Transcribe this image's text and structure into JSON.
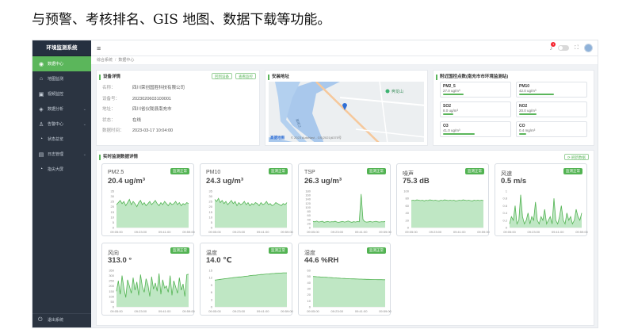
{
  "caption": "与预警、考核排名、GIS 地图、数据下载等功能。",
  "sidebar": {
    "brand": "环境监测系统",
    "items": [
      {
        "label": "数据中心",
        "icon": "camera-icon",
        "glyph": "◉",
        "active": true,
        "chevron": ""
      },
      {
        "label": "地图监测",
        "icon": "map-icon",
        "glyph": "⌂",
        "active": false,
        "chevron": ""
      },
      {
        "label": "视频监控",
        "icon": "video-icon",
        "glyph": "▣",
        "active": false,
        "chevron": ""
      },
      {
        "label": "数据分析",
        "icon": "analysis-icon",
        "glyph": "◈",
        "active": false,
        "chevron": "⌄"
      },
      {
        "label": "告警中心",
        "icon": "alarm-icon",
        "glyph": "♙",
        "active": false,
        "chevron": "⌄"
      },
      {
        "label": "状态总览",
        "icon": "status-icon",
        "glyph": "◔",
        "active": false,
        "chevron": ""
      },
      {
        "label": "日志管理",
        "icon": "log-icon",
        "glyph": "▤",
        "active": false,
        "chevron": "⌄"
      },
      {
        "label": "指尖大屏",
        "icon": "screen-icon",
        "glyph": "◔",
        "active": false,
        "chevron": ""
      }
    ],
    "logout": "退出系统"
  },
  "topbar": {
    "hamburger": "≡",
    "notify_count": "1",
    "bell_glyph": "🔔",
    "fullscreen_glyph": "⛶"
  },
  "breadcrumb": [
    "综合系统",
    "数据中心"
  ],
  "device": {
    "title": "设备详情",
    "btn1": "回到设备",
    "btn2": "查看监控",
    "rows": [
      {
        "k": "名称：",
        "v": "四川荣创国胜科技有限公司"
      },
      {
        "k": "设备号：",
        "v": "2023020603100001"
      },
      {
        "k": "地址：",
        "v": "四川省仪陇县南充市"
      },
      {
        "k": "状态：",
        "v": "在线"
      },
      {
        "k": "数据时间：",
        "v": "2023-03-17 10:04:00"
      }
    ]
  },
  "map": {
    "title": "安装地址",
    "poi": "奔龙山",
    "logo": "高德地图",
    "copyright": "© 2023 AutoNavi - GS(2021)6375号",
    "road": "嘉陵江"
  },
  "air": {
    "title": "附近国控点数(南充市市环境监测站)",
    "items": [
      {
        "name": "PM2_5",
        "value": "27.0 ug/m³",
        "fill": 0.3
      },
      {
        "name": "PM10",
        "value": "42.0 ug/m³",
        "fill": 0.5
      },
      {
        "name": "SO2",
        "value": "8.0 ug/m³",
        "fill": 0.15
      },
      {
        "name": "NO2",
        "value": "20.0 ug/m³",
        "fill": 0.25
      },
      {
        "name": "O3",
        "value": "41.0 ug/m³",
        "fill": 0.45
      },
      {
        "name": "CO",
        "value": "0.4 mg/m³",
        "fill": 0.1
      }
    ]
  },
  "realtime": {
    "title": "实时监测数据详情",
    "refresh": "⟳ 刷新数据"
  },
  "chart_data": [
    {
      "type": "area",
      "name": "PM2.5",
      "display": "20.4 ug/m³",
      "badge": "监测正常",
      "ylim": [
        0,
        35
      ],
      "yticks": [
        0,
        5,
        10,
        15,
        20,
        25,
        30,
        35
      ],
      "xticks": [
        "09:05:00",
        "09:23:00",
        "09:41:00",
        "09:59:00"
      ],
      "values": [
        22,
        24,
        26,
        23,
        25,
        21,
        24,
        27,
        22,
        25,
        23,
        20,
        24,
        26,
        22,
        24,
        21,
        23,
        25,
        22,
        24,
        26,
        23,
        21,
        24,
        22,
        25,
        23,
        21,
        24,
        22,
        23,
        25,
        22,
        24,
        21,
        23,
        22,
        24,
        23
      ]
    },
    {
      "type": "area",
      "name": "PM10",
      "display": "24.3 ug/m³",
      "badge": "监测正常",
      "ylim": [
        0,
        35
      ],
      "yticks": [
        0,
        5,
        10,
        15,
        20,
        25,
        30,
        35
      ],
      "xticks": [
        "09:05:00",
        "09:23:00",
        "09:41:00",
        "09:59:00"
      ],
      "values": [
        27,
        25,
        28,
        24,
        26,
        23,
        25,
        22,
        24,
        26,
        23,
        25,
        21,
        24,
        22,
        23,
        25,
        22,
        24,
        21,
        23,
        22,
        24,
        23,
        21,
        24,
        22,
        23,
        25,
        22,
        23,
        21,
        22,
        24,
        23,
        22,
        21,
        23,
        22,
        24
      ]
    },
    {
      "type": "area",
      "name": "TSP",
      "display": "26.3 ug/m³",
      "badge": "监测正常",
      "ylim": [
        0,
        180
      ],
      "yticks": [
        0,
        20,
        40,
        60,
        80,
        100,
        120,
        140,
        160,
        180
      ],
      "xticks": [
        "09:05:00",
        "09:23:00",
        "09:41:00",
        "09:59:00"
      ],
      "values": [
        30,
        28,
        32,
        27,
        29,
        31,
        26,
        28,
        30,
        27,
        29,
        28,
        31,
        27,
        26,
        28,
        30,
        27,
        29,
        32,
        28,
        26,
        29,
        27,
        30,
        28,
        165,
        40,
        29,
        27,
        28,
        30,
        27,
        29,
        31,
        28,
        27,
        29,
        28,
        30
      ]
    },
    {
      "type": "area",
      "name": "噪声",
      "display": "75.3 dB",
      "badge": "监测正常",
      "ylim": [
        0,
        100
      ],
      "yticks": [
        0,
        20,
        40,
        60,
        80,
        100
      ],
      "xticks": [
        "09:05:00",
        "09:23:00",
        "09:41:00",
        "09:59:00"
      ],
      "values": [
        74,
        75,
        74,
        76,
        75,
        74,
        75,
        73,
        75,
        74,
        76,
        75,
        74,
        75,
        74,
        73,
        75,
        74,
        76,
        75,
        74,
        75,
        74,
        75,
        73,
        74,
        75,
        74,
        76,
        75,
        74,
        75,
        74,
        73,
        75,
        74,
        75,
        74,
        75,
        74
      ]
    },
    {
      "type": "area",
      "name": "风速",
      "display": "0.5 m/s",
      "badge": "监测正常",
      "ylim": [
        0,
        1
      ],
      "yticks": [
        0,
        0.2,
        0.4,
        0.6,
        0.8,
        1
      ],
      "xticks": [
        "09:05:00",
        "09:23:00",
        "09:41:00",
        "09:59:00"
      ],
      "values": [
        0.1,
        0.3,
        0.2,
        0.6,
        0.1,
        0.2,
        0.9,
        0.3,
        0.1,
        0.2,
        0.4,
        0.1,
        0.3,
        0.2,
        0.7,
        0.2,
        0.1,
        0.3,
        0.2,
        0.5,
        0.1,
        0.2,
        0.3,
        0.1,
        0.8,
        0.2,
        0.1,
        0.3,
        0.6,
        0.2,
        0.1,
        0.4,
        0.2,
        0.3,
        0.1,
        0.2,
        0.5,
        0.3,
        0.2,
        0.4
      ]
    },
    {
      "type": "area",
      "name": "风向",
      "display": "313.0 °",
      "badge": "监测正常",
      "ylim": [
        0,
        350
      ],
      "yticks": [
        0,
        50,
        100,
        150,
        200,
        250,
        300,
        350
      ],
      "xticks": [
        "09:05:00",
        "09:23:00",
        "09:41:00",
        "09:59:00"
      ],
      "values": [
        150,
        250,
        120,
        300,
        180,
        90,
        260,
        200,
        130,
        280,
        160,
        240,
        110,
        310,
        190,
        140,
        270,
        210,
        100,
        290,
        170,
        230,
        150,
        320,
        120,
        260,
        180,
        200,
        140,
        300,
        110,
        250,
        190,
        130,
        280,
        160,
        220,
        100,
        310,
        313
      ]
    },
    {
      "type": "area",
      "name": "温度",
      "display": "14.0 ℃",
      "badge": "监测正常",
      "ylim": [
        0,
        15
      ],
      "yticks": [
        0,
        3,
        6,
        9,
        12,
        15
      ],
      "xticks": [
        "09:05:00",
        "09:23:00",
        "09:41:00",
        "09:59:00"
      ],
      "values": [
        11,
        11.1,
        11.2,
        11.3,
        11.4,
        11.5,
        11.6,
        11.7,
        11.8,
        11.9,
        12,
        12.1,
        12.2,
        12.3,
        12.3,
        12.4,
        12.5,
        12.6,
        12.7,
        12.8,
        12.9,
        13,
        13,
        13.1,
        13.2,
        13.3,
        13.3,
        13.4,
        13.5,
        13.5,
        13.6,
        13.7,
        13.7,
        13.8,
        13.8,
        13.9,
        13.9,
        14,
        14,
        14
      ]
    },
    {
      "type": "area",
      "name": "湿度",
      "display": "44.6 %RH",
      "badge": "监测正常",
      "ylim": [
        0,
        60
      ],
      "yticks": [
        0,
        10,
        20,
        30,
        40,
        50,
        60
      ],
      "xticks": [
        "09:05:00",
        "09:23:00",
        "09:41:00",
        "09:59:00"
      ],
      "values": [
        50,
        49.8,
        49.6,
        49.4,
        49.2,
        49,
        48.8,
        48.6,
        48.4,
        48.2,
        48,
        47.8,
        47.6,
        47.4,
        47.2,
        47,
        46.8,
        46.7,
        46.5,
        46.4,
        46.2,
        46.1,
        46,
        45.9,
        45.8,
        45.7,
        45.6,
        45.5,
        45.4,
        45.3,
        45.2,
        45.1,
        45,
        44.9,
        44.9,
        44.8,
        44.7,
        44.7,
        44.6,
        44.6
      ]
    }
  ]
}
